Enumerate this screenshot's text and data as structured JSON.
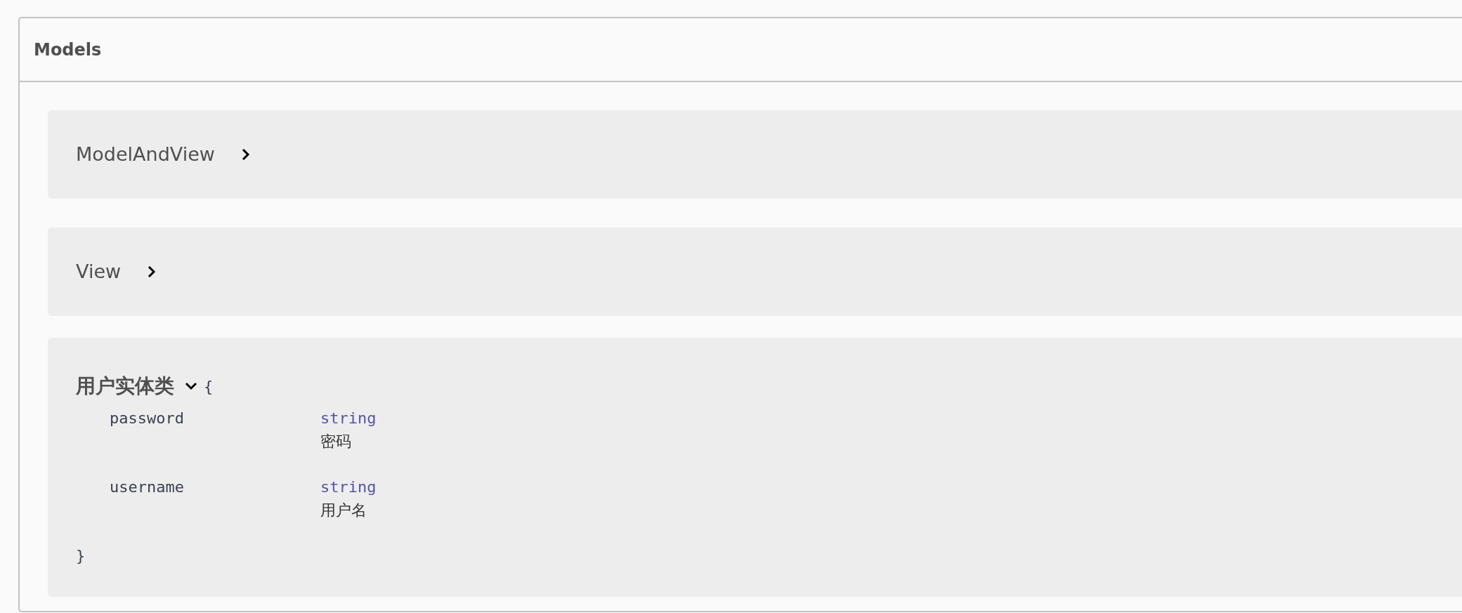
{
  "section": {
    "title": "Models"
  },
  "models": [
    {
      "name": "ModelAndView",
      "expanded": false
    },
    {
      "name": "View",
      "expanded": false
    },
    {
      "name": "用户实体类",
      "expanded": true,
      "open_brace": "{",
      "close_brace": "}",
      "properties": [
        {
          "name": "password",
          "type": "string",
          "description": "密码"
        },
        {
          "name": "username",
          "type": "string",
          "description": "用户名"
        }
      ]
    }
  ]
}
